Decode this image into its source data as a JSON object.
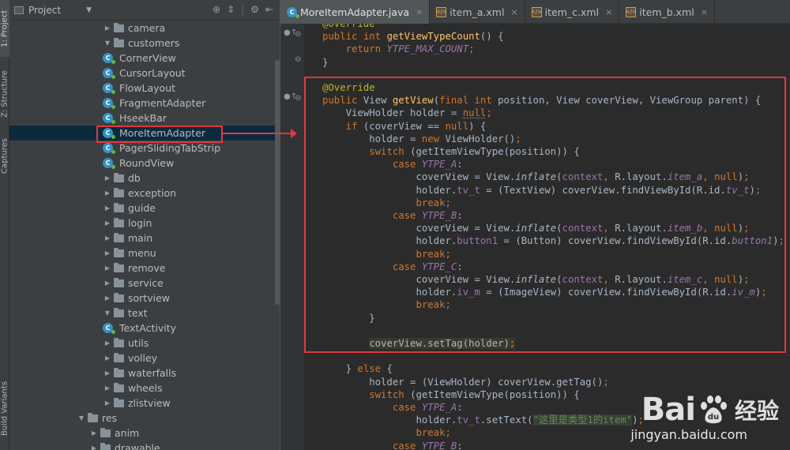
{
  "tool_strip": {
    "tabs": [
      "1: Project",
      "Z: Structure",
      "Captures",
      "Build Variants"
    ]
  },
  "project_panel": {
    "title": "Project",
    "dropdown_icon": "chevron-down-icon",
    "toolbar_icons": [
      "target-icon",
      "split-icon",
      "gear-icon",
      "hide-icon"
    ],
    "tree": [
      {
        "label": "camera",
        "type": "folder",
        "expanded": false,
        "depth": 2
      },
      {
        "label": "customers",
        "type": "folder",
        "expanded": true,
        "depth": 2
      },
      {
        "label": "CornerView",
        "type": "class",
        "depth": 3
      },
      {
        "label": "CursorLayout",
        "type": "class",
        "depth": 3
      },
      {
        "label": "FlowLayout",
        "type": "class",
        "depth": 3
      },
      {
        "label": "FragmentAdapter",
        "type": "class",
        "depth": 3
      },
      {
        "label": "HseekBar",
        "type": "class",
        "depth": 3
      },
      {
        "label": "MoreItemAdapter",
        "type": "class",
        "depth": 3,
        "selected": true
      },
      {
        "label": "PagerSlidingTabStrip",
        "type": "class",
        "depth": 3
      },
      {
        "label": "RoundView",
        "type": "class",
        "depth": 3
      },
      {
        "label": "db",
        "type": "folder",
        "expanded": false,
        "depth": 2
      },
      {
        "label": "exception",
        "type": "folder",
        "expanded": false,
        "depth": 2
      },
      {
        "label": "guide",
        "type": "folder",
        "expanded": false,
        "depth": 2
      },
      {
        "label": "login",
        "type": "folder",
        "expanded": false,
        "depth": 2
      },
      {
        "label": "main",
        "type": "folder",
        "expanded": false,
        "depth": 2
      },
      {
        "label": "menu",
        "type": "folder",
        "expanded": false,
        "depth": 2
      },
      {
        "label": "remove",
        "type": "folder",
        "expanded": false,
        "depth": 2
      },
      {
        "label": "service",
        "type": "folder",
        "expanded": false,
        "depth": 2
      },
      {
        "label": "sortview",
        "type": "folder",
        "expanded": false,
        "depth": 2
      },
      {
        "label": "text",
        "type": "folder",
        "expanded": true,
        "depth": 2
      },
      {
        "label": "TextActivity",
        "type": "class",
        "depth": 3
      },
      {
        "label": "utils",
        "type": "folder",
        "expanded": false,
        "depth": 2
      },
      {
        "label": "volley",
        "type": "folder",
        "expanded": false,
        "depth": 2
      },
      {
        "label": "waterfalls",
        "type": "folder",
        "expanded": false,
        "depth": 2
      },
      {
        "label": "wheels",
        "type": "folder",
        "expanded": false,
        "depth": 2
      },
      {
        "label": "zlistview",
        "type": "folder",
        "expanded": false,
        "depth": 2
      },
      {
        "label": "res",
        "type": "folder",
        "expanded": true,
        "depth": 0
      },
      {
        "label": "anim",
        "type": "folder",
        "expanded": false,
        "depth": 1
      },
      {
        "label": "drawable",
        "type": "folder",
        "expanded": false,
        "depth": 1
      }
    ]
  },
  "editor": {
    "tabs": [
      {
        "label": "MoreItemAdapter.java",
        "kind": "class",
        "active": true
      },
      {
        "label": "item_a.xml",
        "kind": "xml",
        "active": false
      },
      {
        "label": "item_c.xml",
        "kind": "xml",
        "active": false
      },
      {
        "label": "item_b.xml",
        "kind": "xml",
        "active": false
      }
    ],
    "close_glyph": "×",
    "code": [
      [
        [
          "ann",
          "@Override"
        ]
      ],
      [
        [
          "kw",
          "public "
        ],
        [
          "kw",
          "int "
        ],
        [
          "fn",
          "getViewTypeCount"
        ],
        [
          "",
          "() {"
        ]
      ],
      [
        [
          "",
          "    "
        ],
        [
          "kw",
          "return "
        ],
        [
          "cst",
          "YTPE_MAX_COUNT"
        ],
        [
          "kw",
          ";"
        ]
      ],
      [
        [
          "",
          "}"
        ]
      ],
      [
        [
          "",
          ""
        ]
      ],
      [
        [
          "ann",
          "@Override"
        ]
      ],
      [
        [
          "kw",
          "public "
        ],
        [
          "",
          "View "
        ],
        [
          "fn",
          "getView"
        ],
        [
          "",
          "("
        ],
        [
          "kw",
          "final "
        ],
        [
          "kw",
          "int "
        ],
        [
          "",
          "position, View coverView, ViewGroup parent) {"
        ]
      ],
      [
        [
          "",
          "    ViewHolder holder = "
        ],
        [
          "kw unused",
          "null"
        ],
        [
          "kw",
          ";"
        ]
      ],
      [
        [
          "",
          "    "
        ],
        [
          "kw",
          "if "
        ],
        [
          "",
          "(coverView == "
        ],
        [
          "kw",
          "null"
        ],
        [
          "",
          ") {"
        ]
      ],
      [
        [
          "",
          "        holder = "
        ],
        [
          "kw",
          "new "
        ],
        [
          "",
          "ViewHolder()"
        ],
        [
          "kw",
          ";"
        ]
      ],
      [
        [
          "",
          "        "
        ],
        [
          "kw",
          "switch "
        ],
        [
          "",
          "(getItemViewType(position)) {"
        ]
      ],
      [
        [
          "",
          "            "
        ],
        [
          "kw",
          "case "
        ],
        [
          "cst",
          "YTPE_A"
        ],
        [
          "",
          ":"
        ]
      ],
      [
        [
          "",
          "                coverView = View."
        ],
        [
          "it",
          "inflate"
        ],
        [
          "",
          "("
        ],
        [
          "fld",
          "context"
        ],
        [
          "kw",
          ", "
        ],
        [
          "",
          "R.layout."
        ],
        [
          "cst",
          "item_a"
        ],
        [
          "kw",
          ", "
        ],
        [
          "kw",
          "null"
        ],
        [
          "",
          ")"
        ],
        [
          "kw",
          ";"
        ]
      ],
      [
        [
          "",
          "                holder."
        ],
        [
          "fld",
          "tv_t"
        ],
        [
          "",
          " = (TextView) coverView.findViewById(R.id."
        ],
        [
          "cst",
          "tv_t"
        ],
        [
          "",
          ")"
        ],
        [
          "kw",
          ";"
        ]
      ],
      [
        [
          "",
          "                "
        ],
        [
          "kw",
          "break;"
        ]
      ],
      [
        [
          "",
          "            "
        ],
        [
          "kw",
          "case "
        ],
        [
          "cst",
          "YTPE_B"
        ],
        [
          "",
          ":"
        ]
      ],
      [
        [
          "",
          "                coverView = View."
        ],
        [
          "it",
          "inflate"
        ],
        [
          "",
          "("
        ],
        [
          "fld",
          "context"
        ],
        [
          "kw",
          ", "
        ],
        [
          "",
          "R.layout."
        ],
        [
          "cst",
          "item_b"
        ],
        [
          "kw",
          ", "
        ],
        [
          "kw",
          "null"
        ],
        [
          "",
          ")"
        ],
        [
          "kw",
          ";"
        ]
      ],
      [
        [
          "",
          "                holder."
        ],
        [
          "fld",
          "button1"
        ],
        [
          "",
          " = (Button) coverView.findViewById(R.id."
        ],
        [
          "cst",
          "button1"
        ],
        [
          "",
          ")"
        ],
        [
          "kw",
          ";"
        ]
      ],
      [
        [
          "",
          "                "
        ],
        [
          "kw",
          "break;"
        ]
      ],
      [
        [
          "",
          "            "
        ],
        [
          "kw",
          "case "
        ],
        [
          "cst",
          "YTPE_C"
        ],
        [
          "",
          ":"
        ]
      ],
      [
        [
          "",
          "                coverView = View."
        ],
        [
          "it",
          "inflate"
        ],
        [
          "",
          "("
        ],
        [
          "fld",
          "context"
        ],
        [
          "kw",
          ", "
        ],
        [
          "",
          "R.layout."
        ],
        [
          "cst",
          "item_c"
        ],
        [
          "kw",
          ", "
        ],
        [
          "kw",
          "null"
        ],
        [
          "",
          ")"
        ],
        [
          "kw",
          ";"
        ]
      ],
      [
        [
          "",
          "                holder."
        ],
        [
          "fld",
          "iv_m"
        ],
        [
          "",
          " = (ImageView) coverView.findViewById(R.id."
        ],
        [
          "cst",
          "iv_m"
        ],
        [
          "",
          ")"
        ],
        [
          "kw",
          ";"
        ]
      ],
      [
        [
          "",
          "                "
        ],
        [
          "kw",
          "break;"
        ]
      ],
      [
        [
          "",
          "        }"
        ]
      ],
      [
        [
          "",
          ""
        ]
      ],
      [
        [
          "",
          "        "
        ],
        [
          "hl",
          "coverView.setTag(holder)"
        ],
        [
          "kw hl",
          ";"
        ]
      ],
      [
        [
          "",
          ""
        ]
      ],
      [
        [
          "",
          "    } "
        ],
        [
          "kw",
          "else "
        ],
        [
          "",
          "{"
        ]
      ],
      [
        [
          "",
          "        holder = (ViewHolder) coverView.getTag()"
        ],
        [
          "kw",
          ";"
        ]
      ],
      [
        [
          "",
          "        "
        ],
        [
          "kw",
          "switch "
        ],
        [
          "",
          "(getItemViewType(position)) {"
        ]
      ],
      [
        [
          "",
          "            "
        ],
        [
          "kw",
          "case "
        ],
        [
          "cst",
          "YTPE_A"
        ],
        [
          "",
          ":"
        ]
      ],
      [
        [
          "",
          "                holder."
        ],
        [
          "fld",
          "tv_t"
        ],
        [
          "",
          ".setText("
        ],
        [
          "str",
          "\"这里是类型1的item\""
        ],
        [
          "",
          ")"
        ],
        [
          "kw",
          ";"
        ]
      ],
      [
        [
          "",
          "                "
        ],
        [
          "kw",
          "break;"
        ]
      ],
      [
        [
          "",
          "            "
        ],
        [
          "kw",
          "case "
        ],
        [
          "cst",
          "YTPE_B"
        ],
        [
          "",
          ":"
        ]
      ]
    ]
  },
  "watermark": {
    "brand": "Bai",
    "brand_suffix": "du",
    "cn": "经验",
    "url": "jingyan.baidu.com"
  },
  "colors": {
    "annotation_red": "#e0383c",
    "selection": "#0d293e",
    "editor_bg": "#2b2b2b",
    "panel_bg": "#3c3f41"
  }
}
